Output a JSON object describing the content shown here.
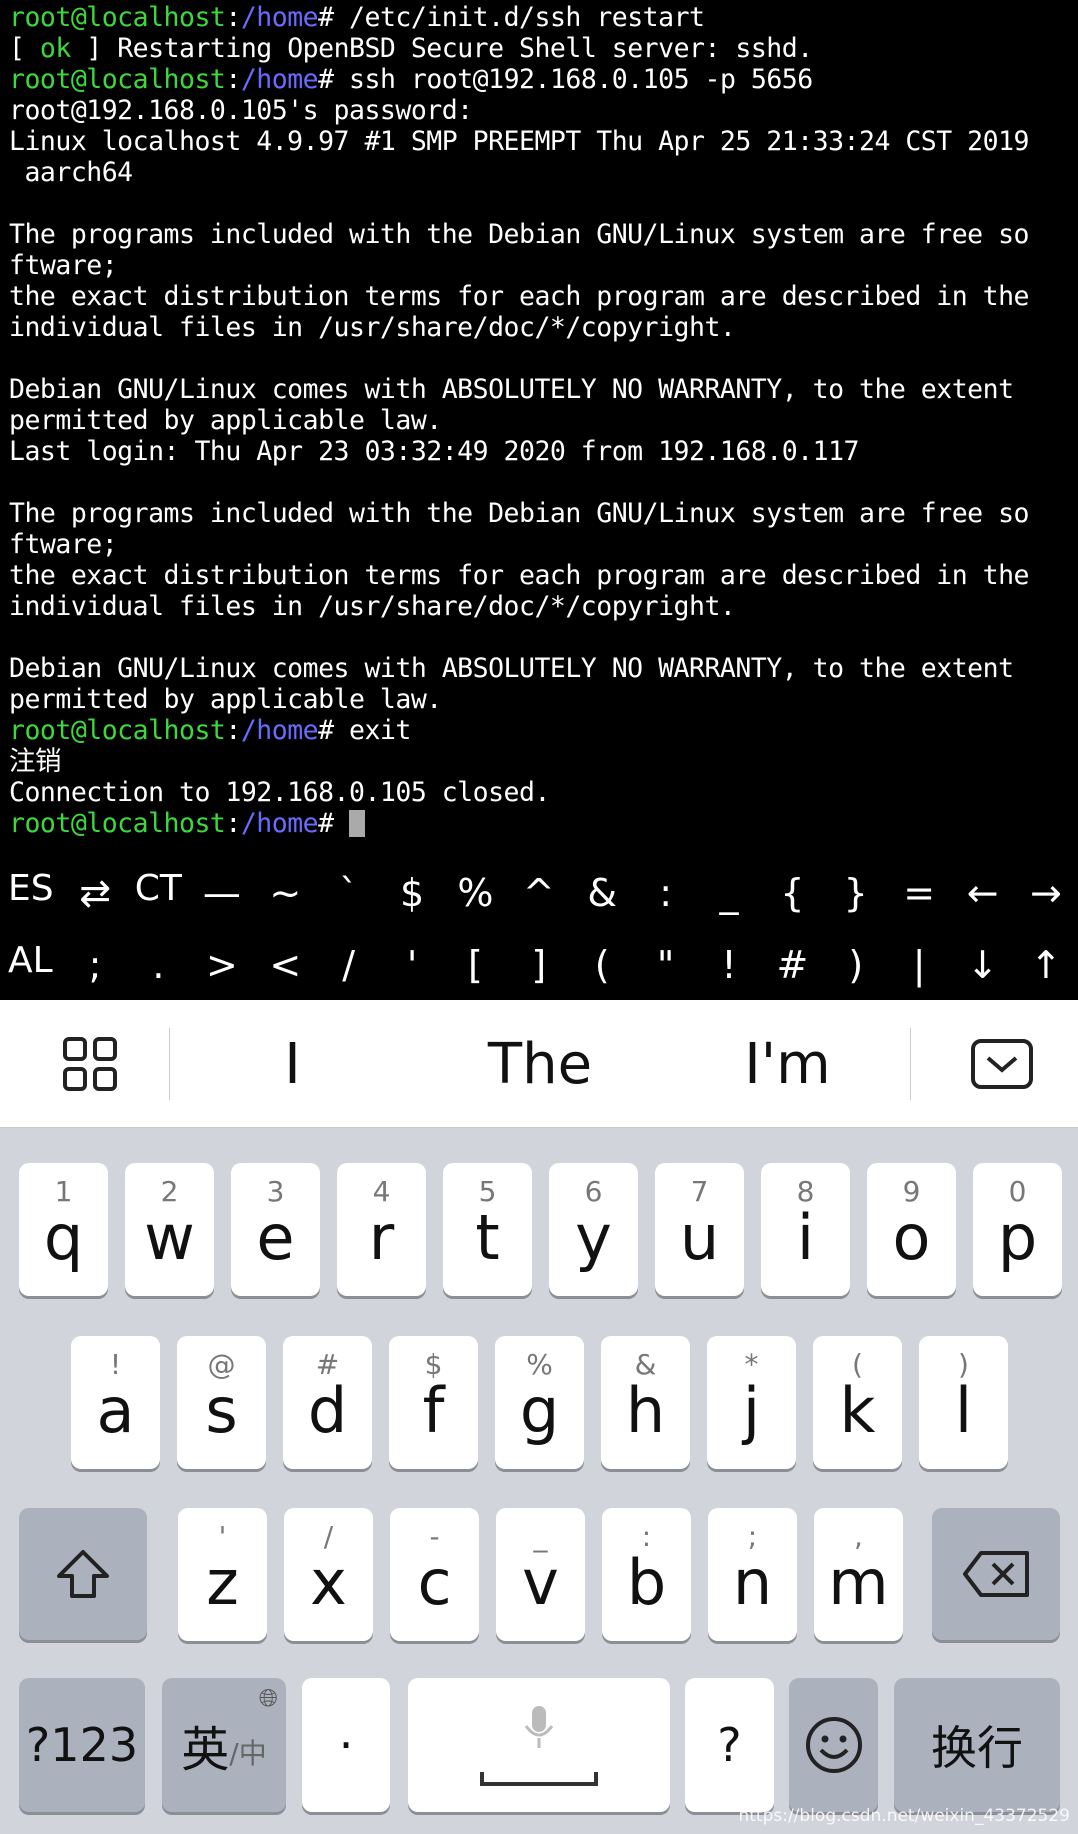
{
  "terminal": {
    "prompt_user": "root@localhost",
    "prompt_path": "/home",
    "lines": [
      {
        "type": "cmd",
        "text": " /etc/init.d/ssh restart"
      },
      {
        "type": "ok",
        "pre": "[ ",
        "ok": "ok",
        "post": " ] Restarting OpenBSD Secure Shell server: sshd."
      },
      {
        "type": "cmd",
        "text": " ssh root@192.168.0.105 -p 5656"
      },
      {
        "type": "out",
        "text": "root@192.168.0.105's password:"
      },
      {
        "type": "out",
        "text": "Linux localhost 4.9.97 #1 SMP PREEMPT Thu Apr 25 21:33:24 CST 2019"
      },
      {
        "type": "out",
        "text": " aarch64"
      },
      {
        "type": "out",
        "text": ""
      },
      {
        "type": "out",
        "text": "The programs included with the Debian GNU/Linux system are free so"
      },
      {
        "type": "out",
        "text": "ftware;"
      },
      {
        "type": "out",
        "text": "the exact distribution terms for each program are described in the"
      },
      {
        "type": "out",
        "text": "individual files in /usr/share/doc/*/copyright."
      },
      {
        "type": "out",
        "text": ""
      },
      {
        "type": "out",
        "text": "Debian GNU/Linux comes with ABSOLUTELY NO WARRANTY, to the extent"
      },
      {
        "type": "out",
        "text": "permitted by applicable law."
      },
      {
        "type": "out",
        "text": "Last login: Thu Apr 23 03:32:49 2020 from 192.168.0.117"
      },
      {
        "type": "out",
        "text": ""
      },
      {
        "type": "out",
        "text": "The programs included with the Debian GNU/Linux system are free so"
      },
      {
        "type": "out",
        "text": "ftware;"
      },
      {
        "type": "out",
        "text": "the exact distribution terms for each program are described in the"
      },
      {
        "type": "out",
        "text": "individual files in /usr/share/doc/*/copyright."
      },
      {
        "type": "out",
        "text": ""
      },
      {
        "type": "out",
        "text": "Debian GNU/Linux comes with ABSOLUTELY NO WARRANTY, to the extent"
      },
      {
        "type": "out",
        "text": "permitted by applicable law."
      },
      {
        "type": "cmd",
        "text": " exit"
      },
      {
        "type": "out",
        "text": "注销"
      },
      {
        "type": "out",
        "text": "Connection to 192.168.0.105 closed."
      },
      {
        "type": "cmd",
        "text": " ",
        "cursor": true
      }
    ]
  },
  "extra_keys": {
    "row1": [
      "ESC",
      "⇄",
      "CTRL",
      "—",
      "~",
      "`",
      "$",
      "%",
      "^",
      "&",
      ":",
      "_",
      "{",
      "}",
      "=",
      "←",
      "→"
    ],
    "row2": [
      "ALT",
      ";",
      ".",
      ">",
      "<",
      "/",
      "'",
      "[",
      "]",
      "(",
      "\"",
      "!",
      "#",
      ")",
      "|",
      "↓",
      "↑"
    ]
  },
  "keyboard": {
    "suggestions": [
      "I",
      "The",
      "I'm"
    ],
    "row1": [
      [
        "1",
        "q"
      ],
      [
        "2",
        "w"
      ],
      [
        "3",
        "e"
      ],
      [
        "4",
        "r"
      ],
      [
        "5",
        "t"
      ],
      [
        "6",
        "y"
      ],
      [
        "7",
        "u"
      ],
      [
        "8",
        "i"
      ],
      [
        "9",
        "o"
      ],
      [
        "0",
        "p"
      ]
    ],
    "row2": [
      [
        "!",
        "a"
      ],
      [
        "@",
        "s"
      ],
      [
        "#",
        "d"
      ],
      [
        "$",
        "f"
      ],
      [
        "%",
        "g"
      ],
      [
        "&",
        "h"
      ],
      [
        "*",
        "j"
      ],
      [
        "(",
        "k"
      ],
      [
        ")",
        "l"
      ]
    ],
    "row3": [
      [
        "'",
        "z"
      ],
      [
        "/",
        "x"
      ],
      [
        "-",
        "c"
      ],
      [
        "_",
        "v"
      ],
      [
        ":",
        "b"
      ],
      [
        ";",
        "n"
      ],
      [
        ",",
        "m"
      ]
    ],
    "numbers_label": "?123",
    "lang_label": "英",
    "lang_sub": "/中",
    "dot_label": "·",
    "question_label": "?",
    "enter_label": "换行"
  },
  "watermark": "https://blog.csdn.net/weixin_43372529"
}
